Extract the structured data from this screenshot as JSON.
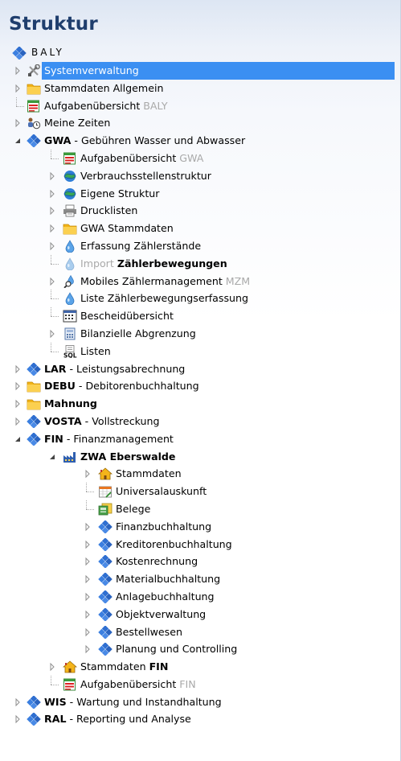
{
  "panel": {
    "title": "Struktur",
    "root": "BALY"
  },
  "items": [
    {
      "level": 1,
      "exp": "closed",
      "icon": "tools-icon",
      "name": "systemverwaltung",
      "label": "Systemverwaltung",
      "selected": true
    },
    {
      "level": 1,
      "exp": "closed",
      "icon": "folder-icon",
      "name": "stammdaten-allgemein",
      "label": "Stammdaten Allgemein"
    },
    {
      "level": 1,
      "exp": "none",
      "icon": "task-list-icon",
      "name": "aufgabenuebersicht-baly",
      "label": "Aufgabenübersicht",
      "suffix": "BALY"
    },
    {
      "level": 1,
      "exp": "closed",
      "icon": "people-clock-icon",
      "name": "meine-zeiten",
      "label": "Meine Zeiten"
    },
    {
      "level": 1,
      "exp": "open",
      "icon": "module-icon",
      "name": "gwa",
      "bold": "GWA",
      "label": " - Gebühren Wasser und Abwasser"
    },
    {
      "level": 2,
      "exp": "none",
      "icon": "task-list-icon",
      "name": "aufgabenuebersicht-gwa",
      "label": "Aufgabenübersicht",
      "suffix": "GWA"
    },
    {
      "level": 2,
      "exp": "closed",
      "icon": "globe-icon",
      "name": "verbrauchsstellenstruktur",
      "label": "Verbrauchsstellenstruktur"
    },
    {
      "level": 2,
      "exp": "closed",
      "icon": "globe-icon",
      "name": "eigene-struktur",
      "label": "Eigene Struktur"
    },
    {
      "level": 2,
      "exp": "closed",
      "icon": "printer-icon",
      "name": "drucklisten",
      "label": "Drucklisten"
    },
    {
      "level": 2,
      "exp": "closed",
      "icon": "folder-icon",
      "name": "gwa-stammdaten",
      "label": "GWA Stammdaten"
    },
    {
      "level": 2,
      "exp": "closed",
      "icon": "water-drop-icon",
      "name": "erfassung-zaehlerstaende",
      "label": "Erfassung Zählerstände"
    },
    {
      "level": 2,
      "exp": "none",
      "icon": "water-drop-faded-icon",
      "name": "import-zaehlerbewegungen",
      "dimprefix": "Import",
      "boldtail": "Zählerbewegungen",
      "label": ""
    },
    {
      "level": 2,
      "exp": "closed",
      "icon": "water-drop-search-icon",
      "name": "mobiles-zaehlermanagement",
      "label": "Mobiles Zählermanagement",
      "suffix": "MZM"
    },
    {
      "level": 2,
      "exp": "none",
      "icon": "water-drop-icon",
      "name": "liste-zaehlerbewegungserfassung",
      "label": "Liste Zählerbewegungserfassung"
    },
    {
      "level": 2,
      "exp": "none",
      "icon": "calculator-icon",
      "name": "bescheiduebersicht",
      "label": "Bescheidübersicht"
    },
    {
      "level": 2,
      "exp": "closed",
      "icon": "calculator-small-icon",
      "name": "bilanzielle-abgrenzung",
      "label": "Bilanzielle Abgrenzung"
    },
    {
      "level": 2,
      "exp": "none",
      "icon": "sql-icon",
      "name": "listen",
      "label": "Listen"
    },
    {
      "level": 1,
      "exp": "closed",
      "icon": "module-icon",
      "name": "lar",
      "bold": "LAR",
      "label": " - Leistungsabrechnung"
    },
    {
      "level": 1,
      "exp": "closed",
      "icon": "folder-icon",
      "name": "debu",
      "bold": "DEBU",
      "label": " - Debitorenbuchhaltung"
    },
    {
      "level": 1,
      "exp": "closed",
      "icon": "folder-icon",
      "name": "mahnung",
      "bold": "Mahnung",
      "label": ""
    },
    {
      "level": 1,
      "exp": "closed",
      "icon": "module-icon",
      "name": "vosta",
      "bold": "VOSTA",
      "label": " - Vollstreckung"
    },
    {
      "level": 1,
      "exp": "open",
      "icon": "module-icon",
      "name": "fin",
      "bold": "FIN",
      "label": " - Finanzmanagement"
    },
    {
      "level": 2,
      "exp": "open",
      "icon": "factory-icon",
      "name": "zwa-eberswalde",
      "bold": "ZWA Eberswalde",
      "label": ""
    },
    {
      "level": 3,
      "exp": "closed",
      "icon": "house-icon",
      "name": "stammdaten-zwa",
      "label": "Stammdaten"
    },
    {
      "level": 3,
      "exp": "none",
      "icon": "calendar-icon",
      "name": "universalauskunft",
      "label": "Universalauskunft"
    },
    {
      "level": 3,
      "exp": "none",
      "icon": "receipts-icon",
      "name": "belege",
      "label": "Belege"
    },
    {
      "level": 3,
      "exp": "closed",
      "icon": "module-icon",
      "name": "finanzbuchhaltung",
      "label": "Finanzbuchhaltung"
    },
    {
      "level": 3,
      "exp": "closed",
      "icon": "module-icon",
      "name": "kreditorenbuchhaltung",
      "label": "Kreditorenbuchhaltung"
    },
    {
      "level": 3,
      "exp": "closed",
      "icon": "module-icon",
      "name": "kostenrechnung",
      "label": "Kostenrechnung"
    },
    {
      "level": 3,
      "exp": "closed",
      "icon": "module-icon",
      "name": "materialbuchhaltung",
      "label": "Materialbuchhaltung"
    },
    {
      "level": 3,
      "exp": "closed",
      "icon": "module-icon",
      "name": "anlagebuchhaltung",
      "label": "Anlagebuchhaltung"
    },
    {
      "level": 3,
      "exp": "closed",
      "icon": "module-icon",
      "name": "objektverwaltung",
      "label": "Objektverwaltung"
    },
    {
      "level": 3,
      "exp": "closed",
      "icon": "module-icon",
      "name": "bestellwesen",
      "label": "Bestellwesen"
    },
    {
      "level": 3,
      "exp": "closed",
      "icon": "module-icon",
      "name": "planung-und-controlling",
      "label": "Planung und Controlling"
    },
    {
      "level": 2,
      "exp": "closed",
      "icon": "house-icon",
      "name": "stammdaten-fin",
      "label": "Stammdaten ",
      "boldtail": "FIN"
    },
    {
      "level": 2,
      "exp": "none",
      "icon": "task-list-icon",
      "name": "aufgabenuebersicht-fin",
      "label": "Aufgabenübersicht",
      "suffix": "FIN"
    },
    {
      "level": 1,
      "exp": "closed",
      "icon": "module-icon",
      "name": "wis",
      "bold": "WIS",
      "label": " - Wartung und Instandhaltung"
    },
    {
      "level": 1,
      "exp": "closed",
      "icon": "module-icon",
      "name": "ral",
      "bold": "RAL",
      "label": " - Reporting und Analyse"
    }
  ]
}
